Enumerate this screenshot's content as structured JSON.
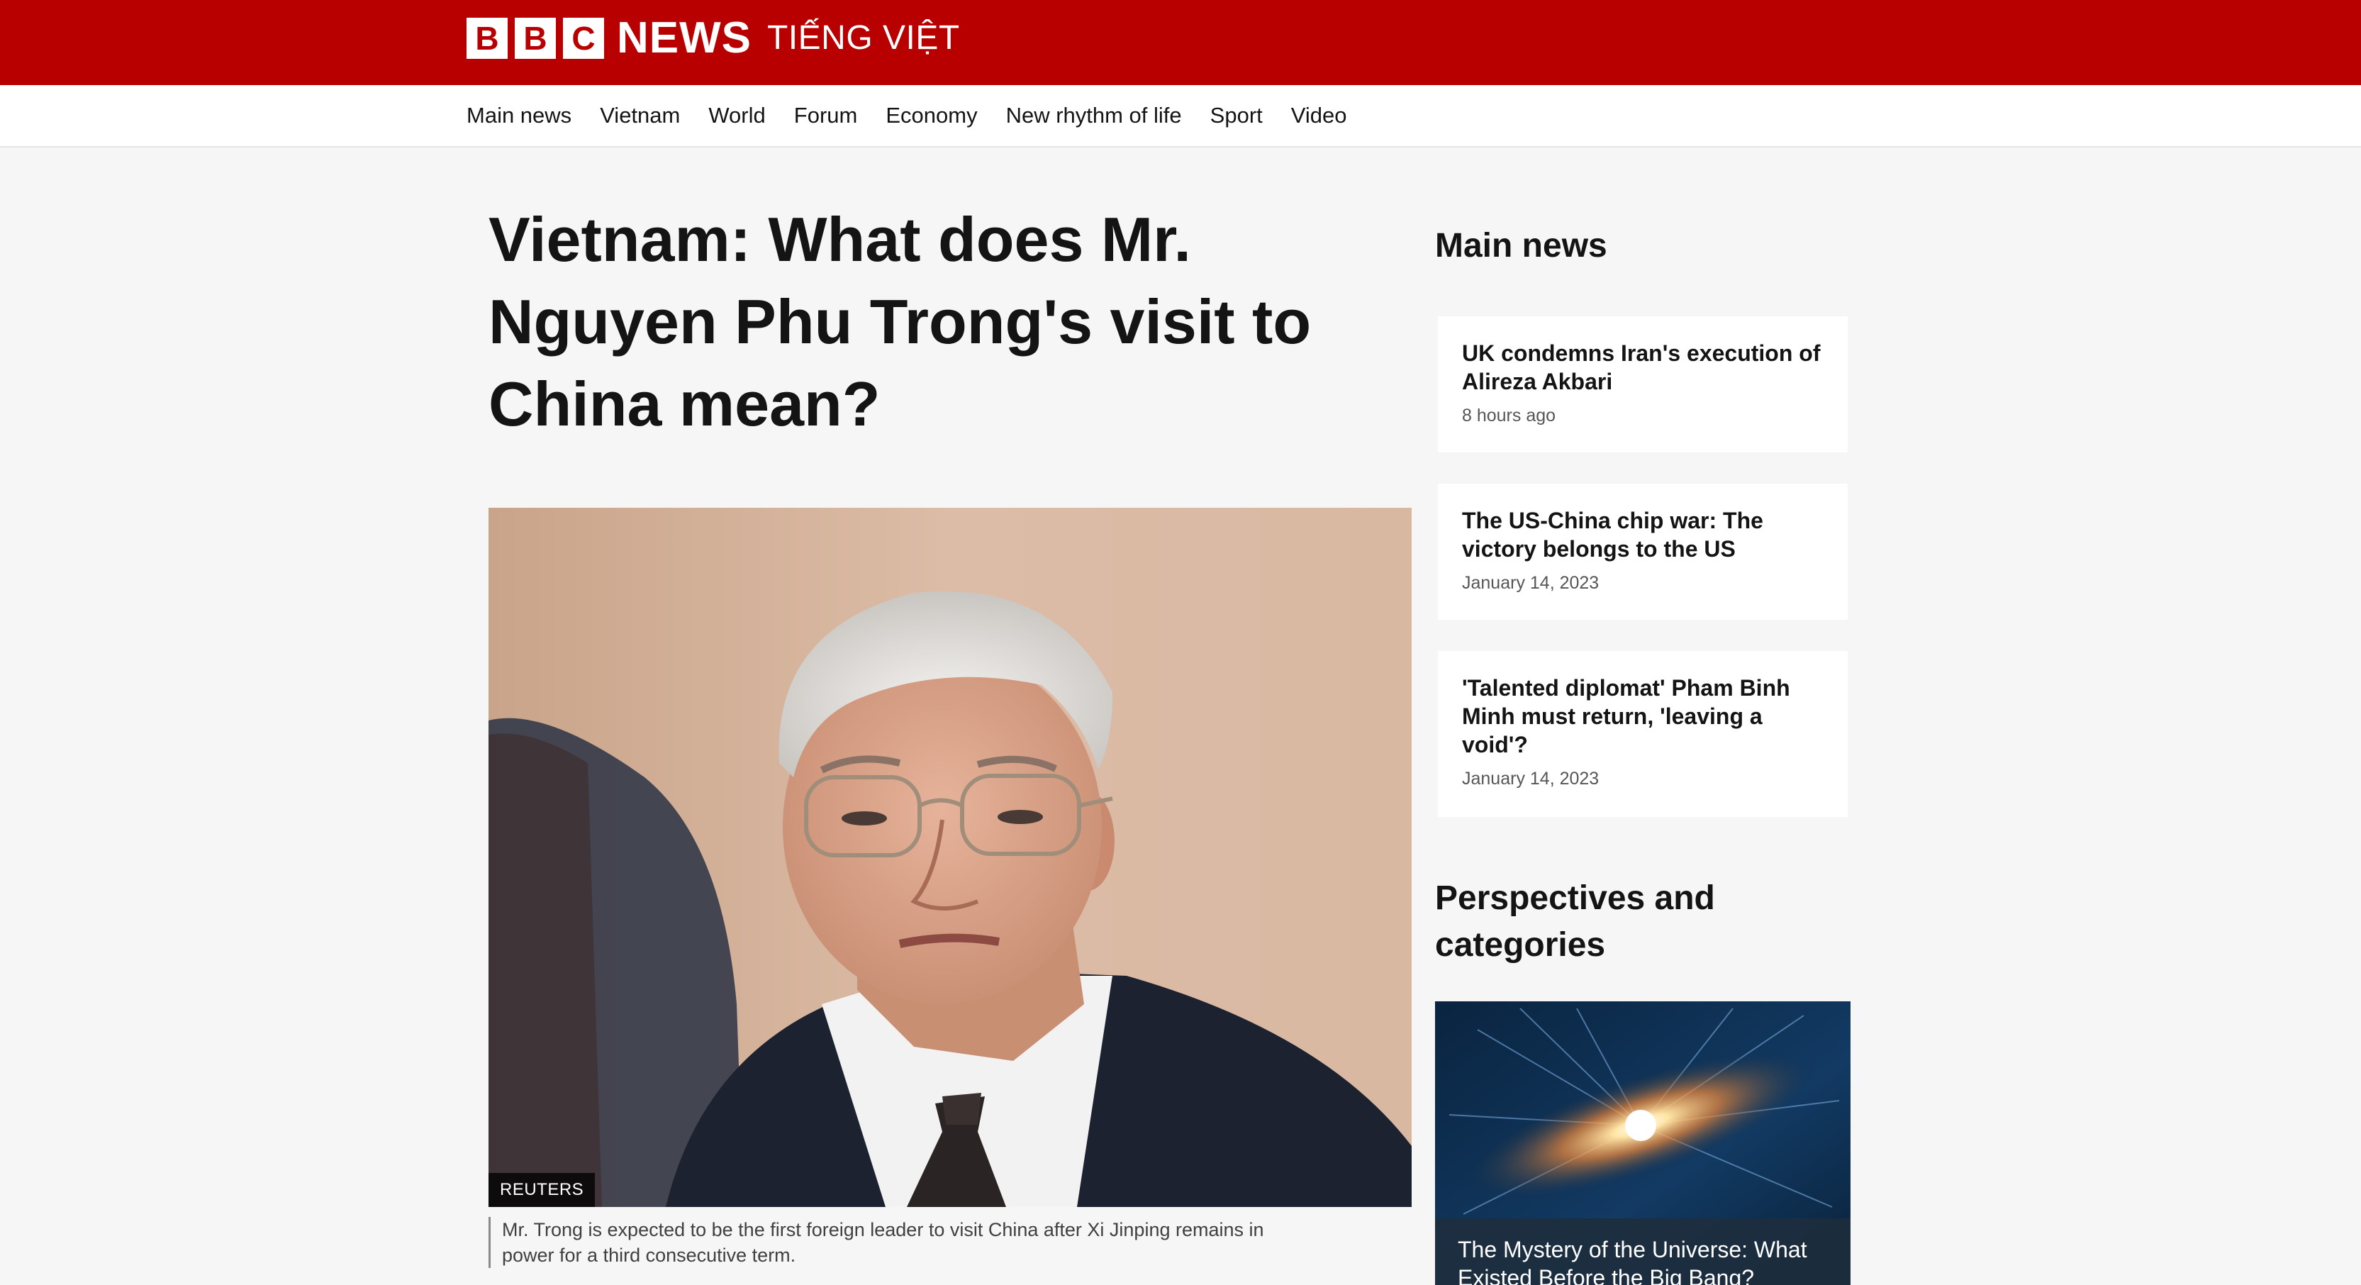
{
  "brand": {
    "letters": [
      "B",
      "B",
      "C"
    ],
    "news": "NEWS",
    "language": "TIẾNG VIỆT"
  },
  "colors": {
    "brand_red": "#b80000",
    "background": "#f6f6f6",
    "text": "#141414"
  },
  "nav": {
    "items": [
      "Main news",
      "Vietnam",
      "World",
      "Forum",
      "Economy",
      "New rhythm of life",
      "Sport",
      "Video"
    ]
  },
  "article": {
    "headline": "Vietnam: What does Mr. Nguyen Phu Trong's visit to China mean?",
    "image_credit": "REUTERS",
    "caption": "Mr. Trong is expected to be the first foreign leader to visit China after Xi Jinping remains in power for a third consecutive term."
  },
  "sidebar": {
    "main_news_heading": "Main news",
    "main_news": [
      {
        "title": "UK condemns Iran's execution of Alireza Akbari",
        "time": "8 hours ago"
      },
      {
        "title": "The US-China chip war: The victory belongs to the US",
        "time": "January 14, 2023"
      },
      {
        "title": "'Talented diplomat' Pham Binh Minh must return, 'leaving a void'?",
        "time": "January 14, 2023"
      }
    ],
    "perspectives_heading": "Perspectives and categories",
    "promo_title": "The Mystery of the Universe: What Existed Before the Big Bang?"
  }
}
